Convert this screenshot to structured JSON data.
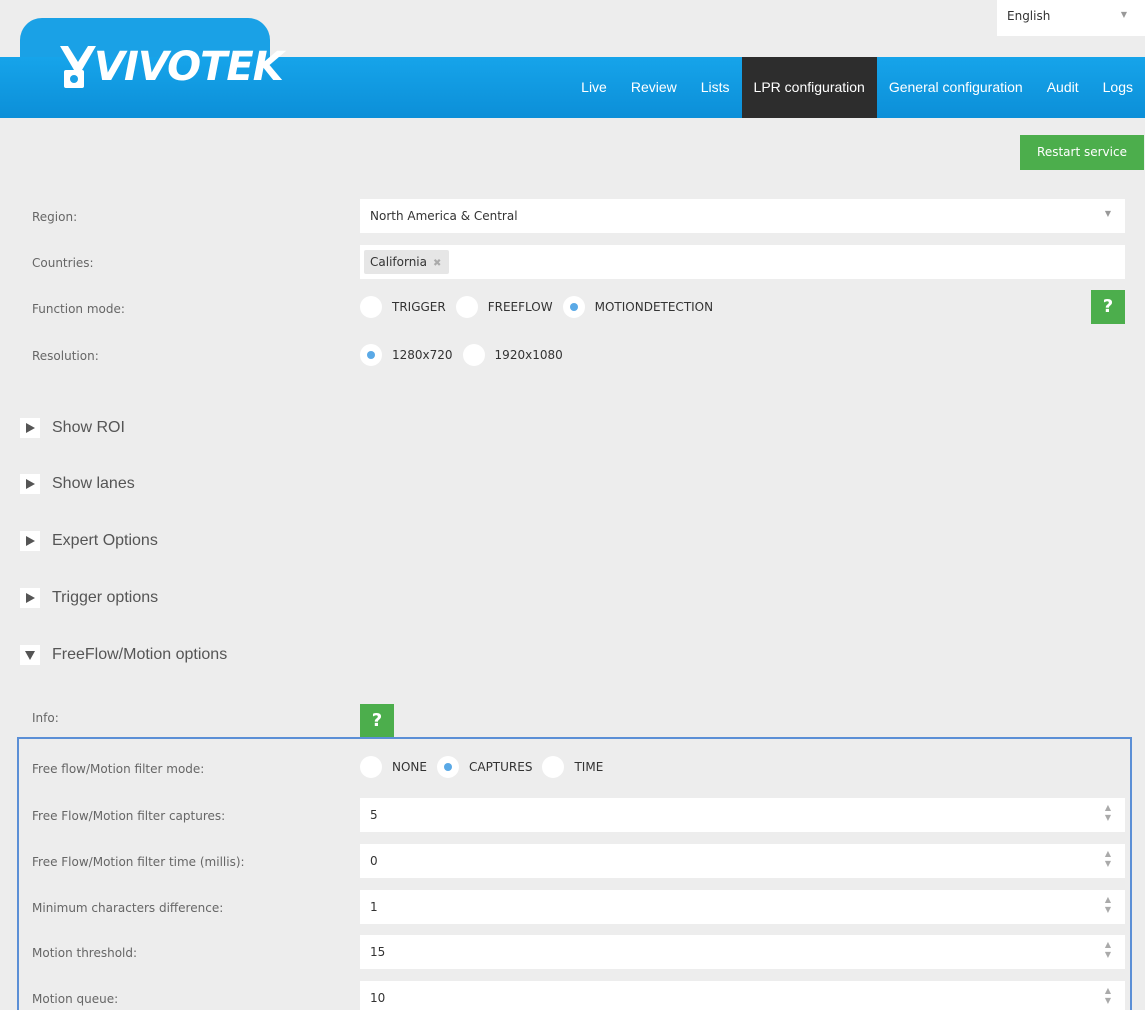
{
  "language": {
    "selected": "English"
  },
  "brand": {
    "name": "VIVOTEK"
  },
  "nav": [
    "Live",
    "Review",
    "Lists",
    "LPR configuration",
    "General configuration",
    "Audit",
    "Logs"
  ],
  "nav_active": "LPR configuration",
  "actions": {
    "restart": "Restart service"
  },
  "form": {
    "region": {
      "label": "Region:",
      "value": "North America & Central"
    },
    "countries": {
      "label": "Countries:",
      "chip": "California",
      "chip_remove": "✖"
    },
    "function_mode": {
      "label": "Function mode:",
      "options": [
        "TRIGGER",
        "FREEFLOW",
        "MOTIONDETECTION"
      ],
      "selected": "MOTIONDETECTION"
    },
    "resolution": {
      "label": "Resolution:",
      "options": [
        "1280x720",
        "1920x1080"
      ],
      "selected": "1280x720"
    }
  },
  "sections": [
    {
      "label": "Show ROI",
      "expanded": false
    },
    {
      "label": "Show lanes",
      "expanded": false
    },
    {
      "label": "Expert Options",
      "expanded": false
    },
    {
      "label": "Trigger options",
      "expanded": false
    },
    {
      "label": "FreeFlow/Motion options",
      "expanded": true
    }
  ],
  "freeflow": {
    "info_label": "Info:",
    "help": "?",
    "filter_mode": {
      "label": "Free flow/Motion filter mode:",
      "options": [
        "NONE",
        "CAPTURES",
        "TIME"
      ],
      "selected": "CAPTURES"
    },
    "fields": [
      {
        "label": "Free Flow/Motion filter captures:",
        "value": "5"
      },
      {
        "label": "Free Flow/Motion filter time (millis):",
        "value": "0"
      },
      {
        "label": "Minimum characters difference:",
        "value": "1"
      },
      {
        "label": "Motion threshold:",
        "value": "15"
      },
      {
        "label": "Motion queue:",
        "value": "10"
      }
    ]
  },
  "colors": {
    "brand_blue": "#1aa1e6",
    "active_tab": "#2d2d2d",
    "green": "#4cae4c",
    "radio_on": "#5aa9e6",
    "panel_border": "#5b8fd6"
  }
}
